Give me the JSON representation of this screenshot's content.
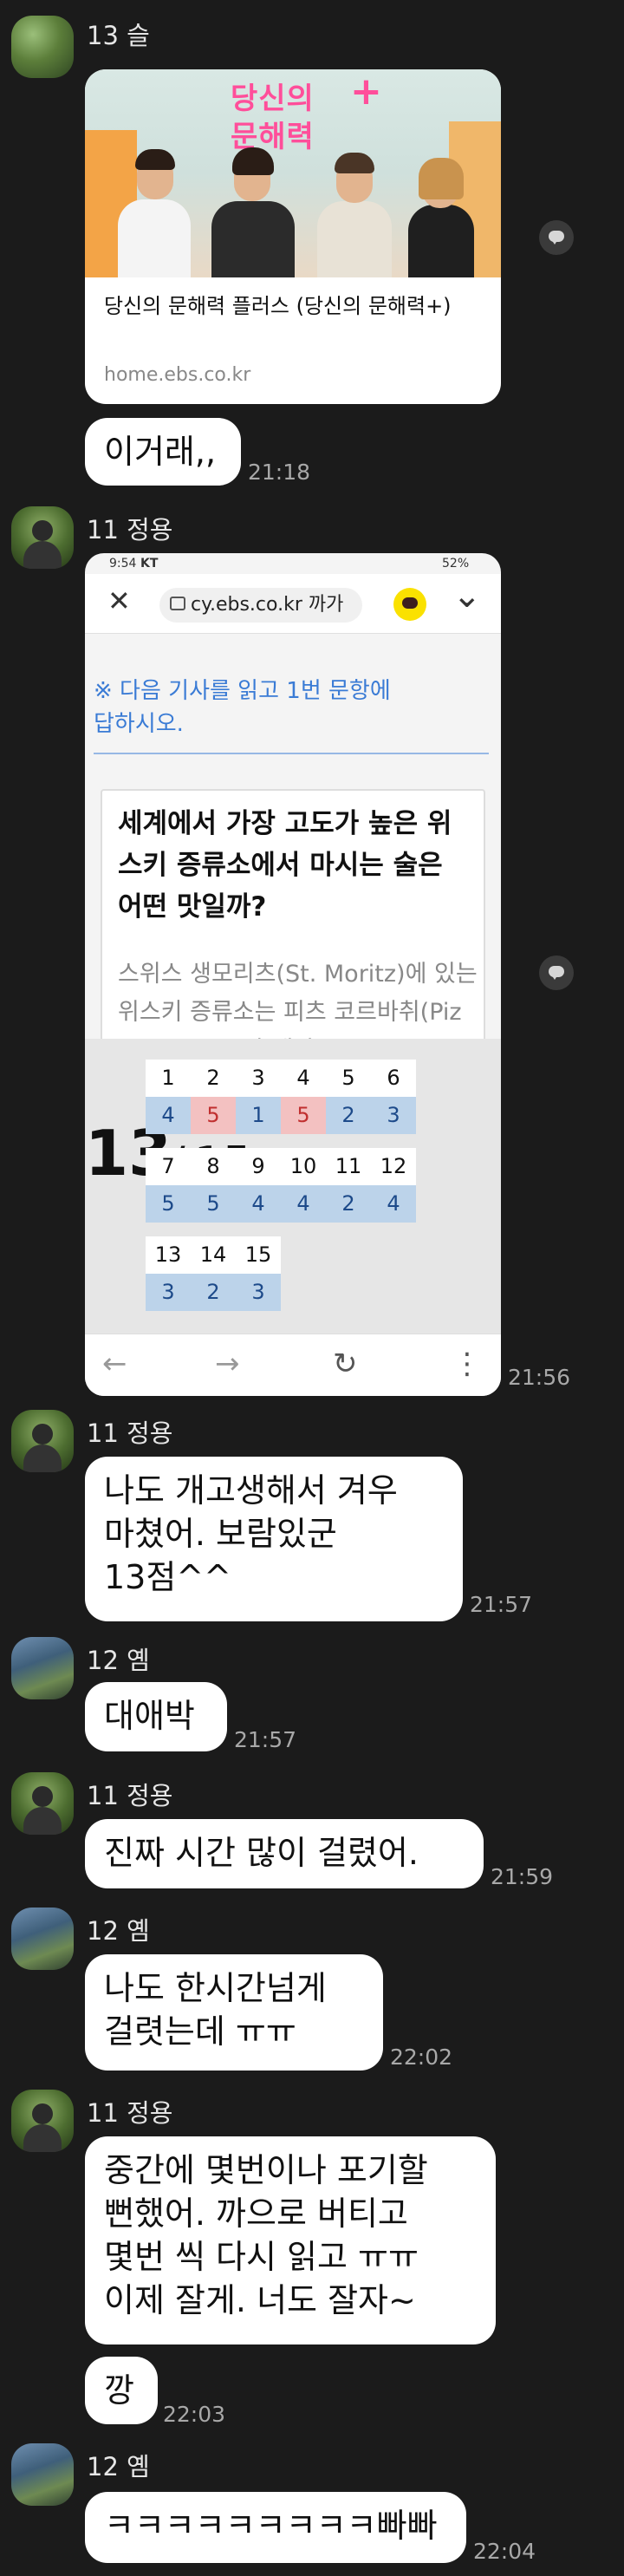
{
  "messages": {
    "m1": {
      "sender": "13 슬",
      "card": {
        "image_logo_line1": "당신의",
        "image_logo_line2": "문해력",
        "image_logo_plus": "+",
        "title": "당신의 문해력 플러스 (당신의 문해력+)",
        "url": "home.ebs.co.kr"
      },
      "text": "이거래,,",
      "time": "21:18"
    },
    "m2": {
      "sender": "11 정용",
      "screenshot": {
        "status_time": "9:54",
        "status_carrier": "KT",
        "status_battery": "52%",
        "close_glyph": "✕",
        "url": "cy.ebs.co.kr 까가",
        "chevron": "⌄",
        "instruction_line1": "※ 다음 기사를 읽고 1번 문항에",
        "instruction_line2": "답하시오.",
        "article_title": "세계에서 가장 고도가 높은 위스키 증류소에서 마시는 술은 어떤 맛일까?",
        "article_body": "스위스 생모리츠(St. Moritz)에 있는 위스키 증류소는 피츠 코르바취(Piz Corvasch) 산 해발",
        "score_value": "13",
        "score_sep": "/",
        "score_total": "15",
        "answers": [
          {
            "n": "1",
            "a": "4",
            "correct": true
          },
          {
            "n": "2",
            "a": "5",
            "correct": false
          },
          {
            "n": "3",
            "a": "1",
            "correct": true
          },
          {
            "n": "4",
            "a": "5",
            "correct": false
          },
          {
            "n": "5",
            "a": "2",
            "correct": true
          },
          {
            "n": "6",
            "a": "3",
            "correct": true
          },
          {
            "n": "7",
            "a": "5",
            "correct": true
          },
          {
            "n": "8",
            "a": "5",
            "correct": true
          },
          {
            "n": "9",
            "a": "4",
            "correct": true
          },
          {
            "n": "10",
            "a": "4",
            "correct": true
          },
          {
            "n": "11",
            "a": "2",
            "correct": true
          },
          {
            "n": "12",
            "a": "4",
            "correct": true
          },
          {
            "n": "13",
            "a": "3",
            "correct": true
          },
          {
            "n": "14",
            "a": "2",
            "correct": true
          },
          {
            "n": "15",
            "a": "3",
            "correct": true
          }
        ],
        "nav_back": "←",
        "nav_forward": "→",
        "nav_reload": "↻",
        "nav_more": "⋮"
      },
      "time": "21:56"
    },
    "m3": {
      "sender": "11 정용",
      "text": "나도 개고생해서 겨우\n마쳤어. 보람있군\n13점^^",
      "time": "21:57"
    },
    "m4": {
      "sender": "12 옘",
      "text": "대애박",
      "time": "21:57"
    },
    "m5": {
      "sender": "11 정용",
      "text": "진짜 시간 많이 걸렸어.",
      "time": "21:59"
    },
    "m6": {
      "sender": "12 옘",
      "text": "나도 한시간넘게\n걸렷는데 ㅠㅠ",
      "time": "22:02"
    },
    "m7": {
      "sender": "11 정용",
      "text": "중간에 몇번이나 포기할\n뻔했어. 까으로 버티고\n몇번 씩 다시 읽고 ㅠㅠ\n이제 잘게. 너도 잘자~",
      "text2": "깡",
      "time": "22:03"
    },
    "m8": {
      "sender": "12 옘",
      "text": "ㅋㅋㅋㅋㅋㅋㅋㅋㅋ빠빠",
      "time": "22:04"
    }
  },
  "icons": {
    "share": "share-bubble-icon",
    "lock": "lock-icon",
    "kakao": "kakao-talk-icon"
  },
  "colors": {
    "background": "#1b1b1b",
    "bubble": "#ffffff",
    "correct": "#bcd3ea",
    "wrong": "#f3c1c1",
    "link_blue": "#3a7bd5"
  }
}
